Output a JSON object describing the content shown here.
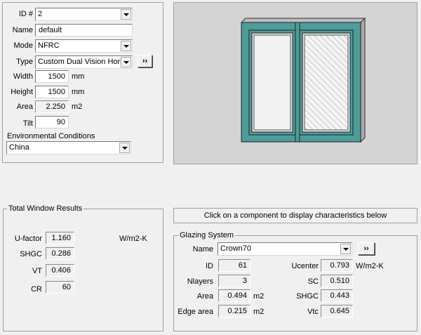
{
  "window_props": {
    "id_label": "ID #",
    "id_value": "2",
    "name_label": "Name",
    "name_value": "default",
    "mode_label": "Mode",
    "mode_value": "NFRC",
    "type_label": "Type",
    "type_value": "Custom Dual Vision Horiz",
    "type_button": "››",
    "width_label": "Width",
    "width_value": "1500",
    "width_unit": "mm",
    "height_label": "Height",
    "height_value": "1500",
    "height_unit": "mm",
    "area_label": "Area",
    "area_value": "2.250",
    "area_unit": "m2",
    "tilt_label": "Tilt",
    "tilt_value": "90",
    "env_label": "Environmental Conditions",
    "env_value": "China"
  },
  "total_results": {
    "title": "Total Window Results",
    "ufactor_label": "U-factor",
    "ufactor_value": "1.160",
    "ufactor_unit": "W/m2-K",
    "shgc_label": "SHGC",
    "shgc_value": "0.286",
    "vt_label": "VT",
    "vt_value": "0.406",
    "cr_label": "CR",
    "cr_value": "60"
  },
  "hint": "Click on a component to display characteristics below",
  "glazing": {
    "title": "Glazing System",
    "name_label": "Name",
    "name_value": "Crown70",
    "name_button": "››",
    "id_label": "ID",
    "id_value": "61",
    "nlayers_label": "Nlayers",
    "nlayers_value": "3",
    "area_label": "Area",
    "area_value": "0.494",
    "area_unit": "m2",
    "edge_label": "Edge area",
    "edge_value": "0.215",
    "edge_unit": "m2",
    "ucenter_label": "Ucenter",
    "ucenter_value": "0.793",
    "ucenter_unit": "W/m2-K",
    "sc_label": "SC",
    "sc_value": "0.510",
    "shgc_label": "SHGC",
    "shgc_value": "0.443",
    "vtc_label": "Vtc",
    "vtc_value": "0.645"
  },
  "colors": {
    "frame": "#4e9c9c",
    "preview_bg": "#d4d4d4"
  }
}
